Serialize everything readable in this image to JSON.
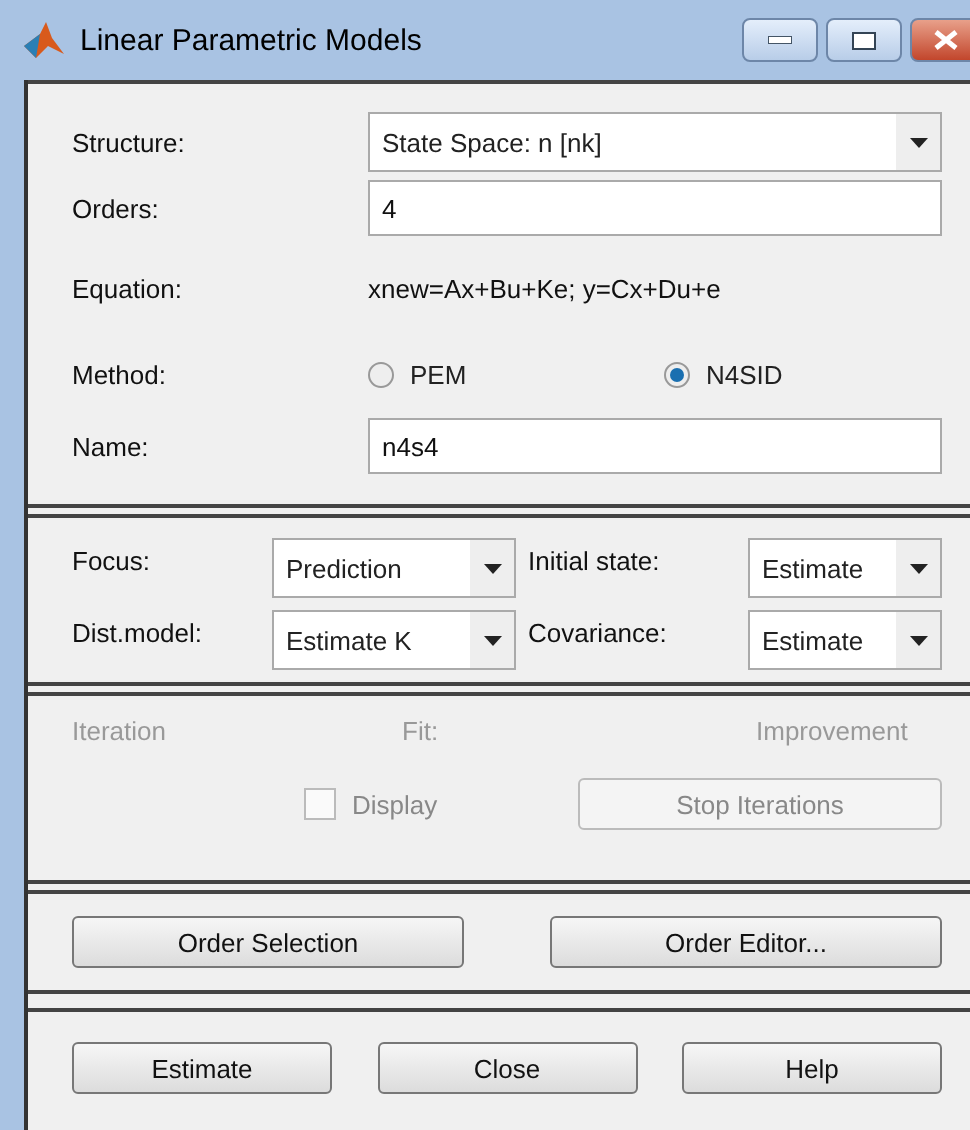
{
  "window": {
    "title": "Linear Parametric Models"
  },
  "model": {
    "structure": {
      "label": "Structure:",
      "value": "State Space: n [nk]"
    },
    "orders": {
      "label": "Orders:",
      "value": "4"
    },
    "equation": {
      "label": "Equation:",
      "value": "xnew=Ax+Bu+Ke; y=Cx+Du+e"
    },
    "method": {
      "label": "Method:",
      "options": [
        {
          "label": "PEM",
          "selected": false
        },
        {
          "label": "N4SID",
          "selected": true
        }
      ]
    },
    "name": {
      "label": "Name:",
      "value": "n4s4"
    }
  },
  "options": [
    {
      "label": "Focus:",
      "value": "Prediction"
    },
    {
      "label": "Initial state:",
      "value": "Estimate"
    },
    {
      "label": "Dist.model:",
      "value": "Estimate K"
    },
    {
      "label": "Covariance:",
      "value": "Estimate"
    }
  ],
  "iteration": {
    "disabled": true,
    "headers": [
      "Iteration",
      "Fit:",
      "Improvement"
    ],
    "display": {
      "label": "Display",
      "checked": false
    },
    "stop_button": "Stop Iterations"
  },
  "order_buttons": [
    "Order Selection",
    "Order Editor..."
  ],
  "buttons": [
    "Estimate",
    "Close",
    "Help"
  ]
}
